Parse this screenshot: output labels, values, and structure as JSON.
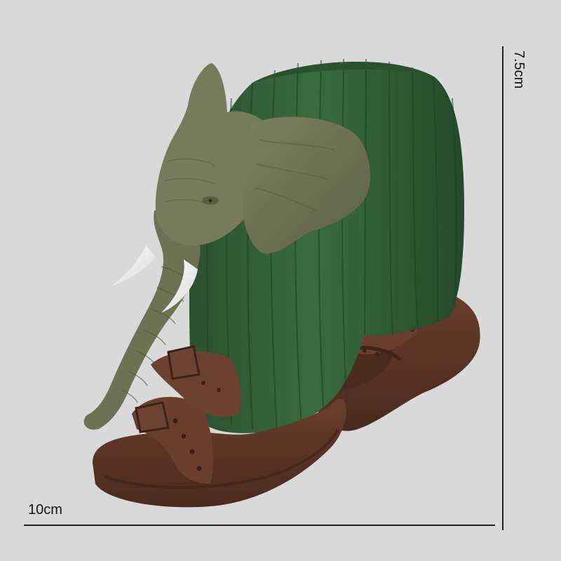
{
  "dimensions": {
    "width_label": "10cm",
    "height_label": "7.5cm"
  },
  "colors": {
    "background": "#d9d9d9",
    "cactus": "#2f5a32",
    "elephant": "#6f7354",
    "sandal": "#5b3325",
    "tusk": "#f3f3f3"
  }
}
